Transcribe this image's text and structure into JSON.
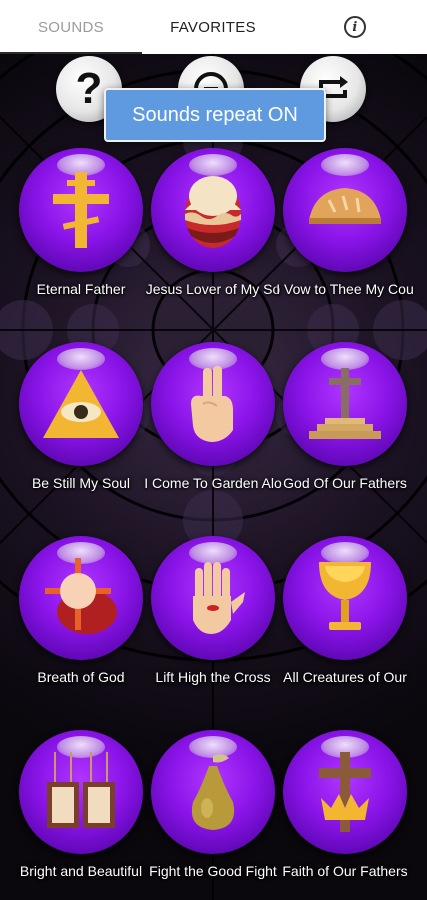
{
  "tabs": {
    "sounds": "SOUNDS",
    "favorites": "FAVORITES",
    "info_glyph": "i"
  },
  "controls": {
    "help_glyph": "?",
    "stop_icon": "stop-icon",
    "repeat_icon": "repeat-icon"
  },
  "toast": "Sounds repeat ON",
  "colors": {
    "orb_purple": "#8a14e8",
    "toast_blue": "#5f9ae0",
    "accent_gold": "#f2b632"
  },
  "sounds": [
    {
      "label": "Eternal Father",
      "icon": "orthodox-cross-icon"
    },
    {
      "label": "Jesus Lover of My So",
      "icon": "easter-egg-icon"
    },
    {
      "label": "I Vow to Thee My Cou",
      "icon": "bread-icon"
    },
    {
      "label": "Be Still My Soul",
      "icon": "eye-of-providence-icon"
    },
    {
      "label": "I Come To Garden Alo",
      "icon": "blessing-hand-icon"
    },
    {
      "label": "God Of Our Fathers",
      "icon": "grave-cross-icon"
    },
    {
      "label": "Breath of God",
      "icon": "host-icon"
    },
    {
      "label": "Lift High the Cross",
      "icon": "stigmata-hand-icon"
    },
    {
      "label": "All Creatures of Our",
      "icon": "chalice-icon"
    },
    {
      "label": "Bright and Beautiful",
      "icon": "scapular-icon"
    },
    {
      "label": "Fight the Good Fight",
      "icon": "pear-icon"
    },
    {
      "label": "Faith of Our Fathers",
      "icon": "cross-crown-icon"
    }
  ]
}
